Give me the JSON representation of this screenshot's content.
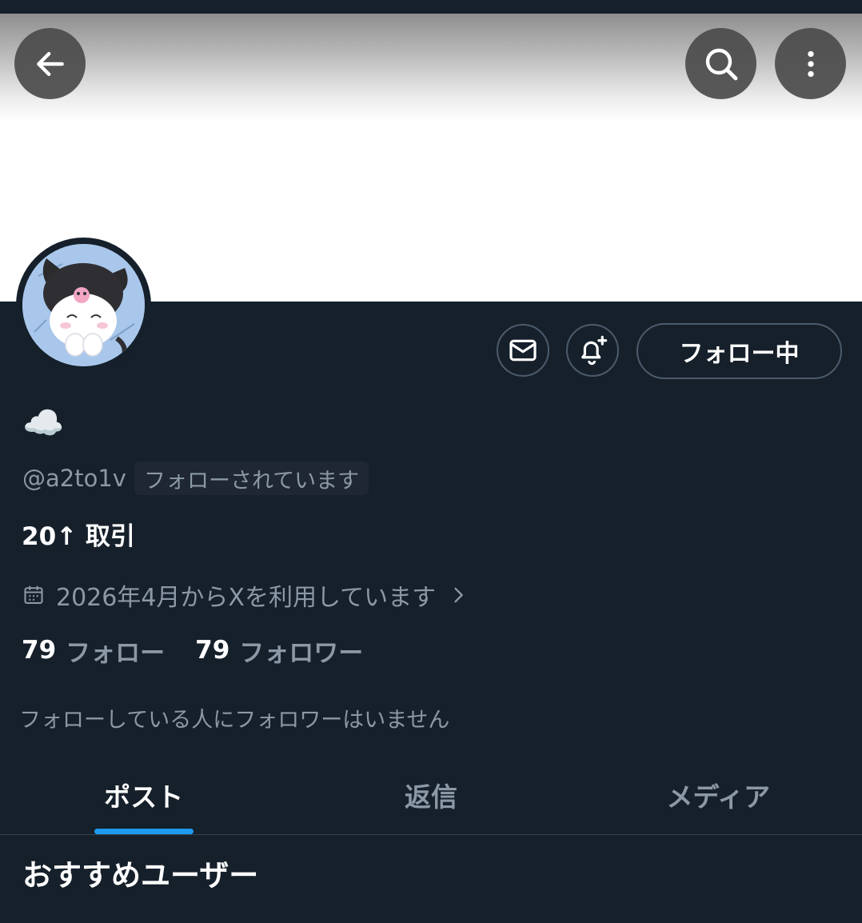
{
  "profile": {
    "display_name": "☁️",
    "handle": "@a2to1v",
    "follows_you_badge": "フォローされています",
    "bio": "20↑ 取引",
    "joined": "2026年4月からXを利用しています",
    "following_count": "79",
    "following_label": "フォロー",
    "followers_count": "79",
    "followers_label": "フォロワー",
    "mutual_note": "フォローしている人にフォロワーはいません"
  },
  "actions": {
    "follow_button_label": "フォロー中"
  },
  "tabs": [
    {
      "label": "ポスト",
      "active": true
    },
    {
      "label": "返信",
      "active": false
    },
    {
      "label": "メディア",
      "active": false
    }
  ],
  "section": {
    "title": "おすすめユーザー"
  },
  "icons": {
    "back": "arrow-left-icon",
    "search": "search-icon",
    "more": "more-vertical-icon",
    "mail": "mail-icon",
    "bell": "bell-plus-icon",
    "calendar": "calendar-icon",
    "chevron": "chevron-right-icon"
  },
  "colors": {
    "background": "#15202b",
    "accent": "#1d9bf0",
    "secondary_text": "#8b98a5",
    "border": "#4b5b6b"
  }
}
